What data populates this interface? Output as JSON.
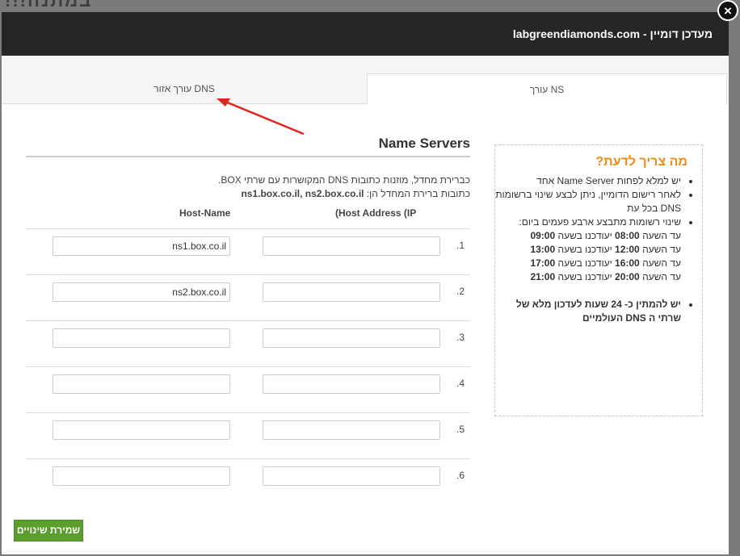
{
  "background": {
    "text": "במתנה!!!"
  },
  "modal": {
    "title": "מעדכן דומיין - labgreendiamonds.com",
    "close_icon": "×"
  },
  "tabs": [
    {
      "label": "עורך NS",
      "active": true
    },
    {
      "label": "עורך אזור DNS",
      "active": false
    }
  ],
  "info": {
    "title": "מה צריך לדעת?",
    "bullets": [
      "יש למלא לפחות Name Server אחד",
      "לאחר רישום הדומיין, ניתן לבצע שינוי ברשומות DNS בכל עת",
      "שינוי רשומות מתבצע ארבע פעמים ביום:"
    ],
    "schedule": [
      {
        "prefix": "עד השעה ",
        "time": "08:00",
        "mid": " יעודכנו בשעה ",
        "update": "09:00"
      },
      {
        "prefix": "עד השעה ",
        "time": "12:00",
        "mid": " יעודכנו בשעה ",
        "update": "13:00"
      },
      {
        "prefix": "עד השעה ",
        "time": "16:00",
        "mid": " יעודכנו בשעה ",
        "update": "17:00"
      },
      {
        "prefix": "עד השעה ",
        "time": "20:00",
        "mid": " יעודכנו בשעה ",
        "update": "21:00"
      }
    ],
    "final_note": "יש להמתין כ- 24 שעות לעדכון מלא של שרתי ה DNS העולמיים"
  },
  "nameservers": {
    "title": "Name Servers",
    "desc_line1": "כברירת מחדל, מוזנות כתובות DNS המקושרות עם שרתי BOX.",
    "desc_line2_label": "כתובות ברירת המחדל הן: ",
    "desc_line2_value": "ns1.box.co.il, ns2.box.co.il",
    "col_ip": "(Host Address (IP",
    "col_host": "Host-Name",
    "rows": [
      {
        "num": ".1",
        "ip": "",
        "host": "ns1.box.co.il"
      },
      {
        "num": ".2",
        "ip": "",
        "host": "ns2.box.co.il"
      },
      {
        "num": ".3",
        "ip": "",
        "host": ""
      },
      {
        "num": ".4",
        "ip": "",
        "host": ""
      },
      {
        "num": ".5",
        "ip": "",
        "host": ""
      },
      {
        "num": ".6",
        "ip": "",
        "host": ""
      }
    ]
  },
  "save_button": {
    "label": "שמירת שינויים"
  },
  "colors": {
    "accent_orange": "#f08a1c",
    "save_green": "#5c9e2e",
    "header_dark": "#262626",
    "arrow_red": "#e3231c"
  }
}
